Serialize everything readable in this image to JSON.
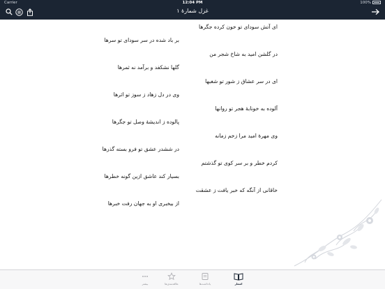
{
  "status_bar": {
    "carrier": "Carrier",
    "time": "12:04 PM",
    "battery": "100%"
  },
  "nav": {
    "title": "غزل شمارهٔ ۱",
    "icons": [
      "search-icon",
      "menu-circle-icon",
      "share-icon",
      "forward-arrow-icon"
    ]
  },
  "verses": [
    {
      "first": "ای آتش سودای تو خون کرده جگرها",
      "second": "بر باد شده در سر سودای تو سرها"
    },
    {
      "first": "در گلشن امید به شاخ شجر من",
      "second": "گلها نشکفد و برآمد نه ثمرها"
    },
    {
      "first": "ای در سر عشاق ز شور تو شغبها",
      "second": "وی در دل زهاد ز سوز تو اثرها"
    },
    {
      "first": "آلوده به خونابهٔ هجر تو روانها",
      "second": "پالوده ز اندیشهٔ وصل تو جگرها"
    },
    {
      "first": "وی مهرهٔ امید مرا زخم زمانه",
      "second": "در ششدر عشق تو فرو بسته گذرها"
    },
    {
      "first": "کردم خطر و بر سر کوی تو گذشتم",
      "second": "بسیار کند عاشق ازین گونه خطرها"
    },
    {
      "first": "خاقانی از آنگه که خبر یافت ز عشقت",
      "second": "از بیخبری او به جهان رفت خبرها"
    }
  ],
  "tabs": [
    {
      "label": "اشعار",
      "icon": "book-icon",
      "active": true
    },
    {
      "label": "یادداشت‌ها",
      "icon": "notes-icon",
      "active": false
    },
    {
      "label": "علاقه‌مندی‌ها",
      "icon": "favorites-icon",
      "active": false
    },
    {
      "label": "بیشتر",
      "icon": "more-icon",
      "active": false
    }
  ]
}
